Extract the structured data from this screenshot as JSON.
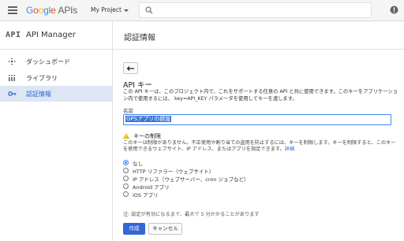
{
  "topbar": {
    "brand_google": [
      "G",
      "o",
      "o",
      "g",
      "l",
      "e"
    ],
    "brand_apis": "APIs",
    "project": "My Project",
    "search_placeholder": ""
  },
  "left_header": {
    "logo": "API",
    "title": "API Manager"
  },
  "page_title": "認証情報",
  "sidebar": {
    "items": [
      {
        "label": "ダッシュボード",
        "icon": "dashboard-icon",
        "active": false
      },
      {
        "label": "ライブラリ",
        "icon": "library-icon",
        "active": false
      },
      {
        "label": "認証情報",
        "icon": "key-icon",
        "active": true
      }
    ]
  },
  "main": {
    "section_title": "API キー",
    "description": "この API キーは、このプロジェクト内で、これをサポートする任意の API と共に使用できます。このキーをアプリケーション内で使用するには、 key=API_KEY パラメータを使用してキーを渡します。",
    "name_label": "名前",
    "name_value": "GPSアプリの鍵盤",
    "restriction_title": "キーの制限",
    "restriction_desc": "このキーは制限がありません。不正使用や割り当ての盗用を防止するには、キーを制限します。キーを制限すると、このキーを使用できるウェブサイト、IP アドレス、またはアプリを指定できます。",
    "restriction_link": "詳細",
    "radios": [
      {
        "label": "なし",
        "checked": true
      },
      {
        "label": "HTTP リファラー（ウェブサイト）",
        "checked": false
      },
      {
        "label": "IP アドレス（ウェブサーバー、cron ジョブなど）",
        "checked": false
      },
      {
        "label": "Android アプリ",
        "checked": false
      },
      {
        "label": "iOS アプリ",
        "checked": false
      }
    ],
    "note": "注: 設定が有効になるまで、最大で 5 分かかることがあります",
    "create_label": "作成",
    "cancel_label": "キャンセル"
  },
  "colors": {
    "accent": "#3367d6",
    "active_bg": "#dde6f3",
    "warning": "#f4b400"
  }
}
